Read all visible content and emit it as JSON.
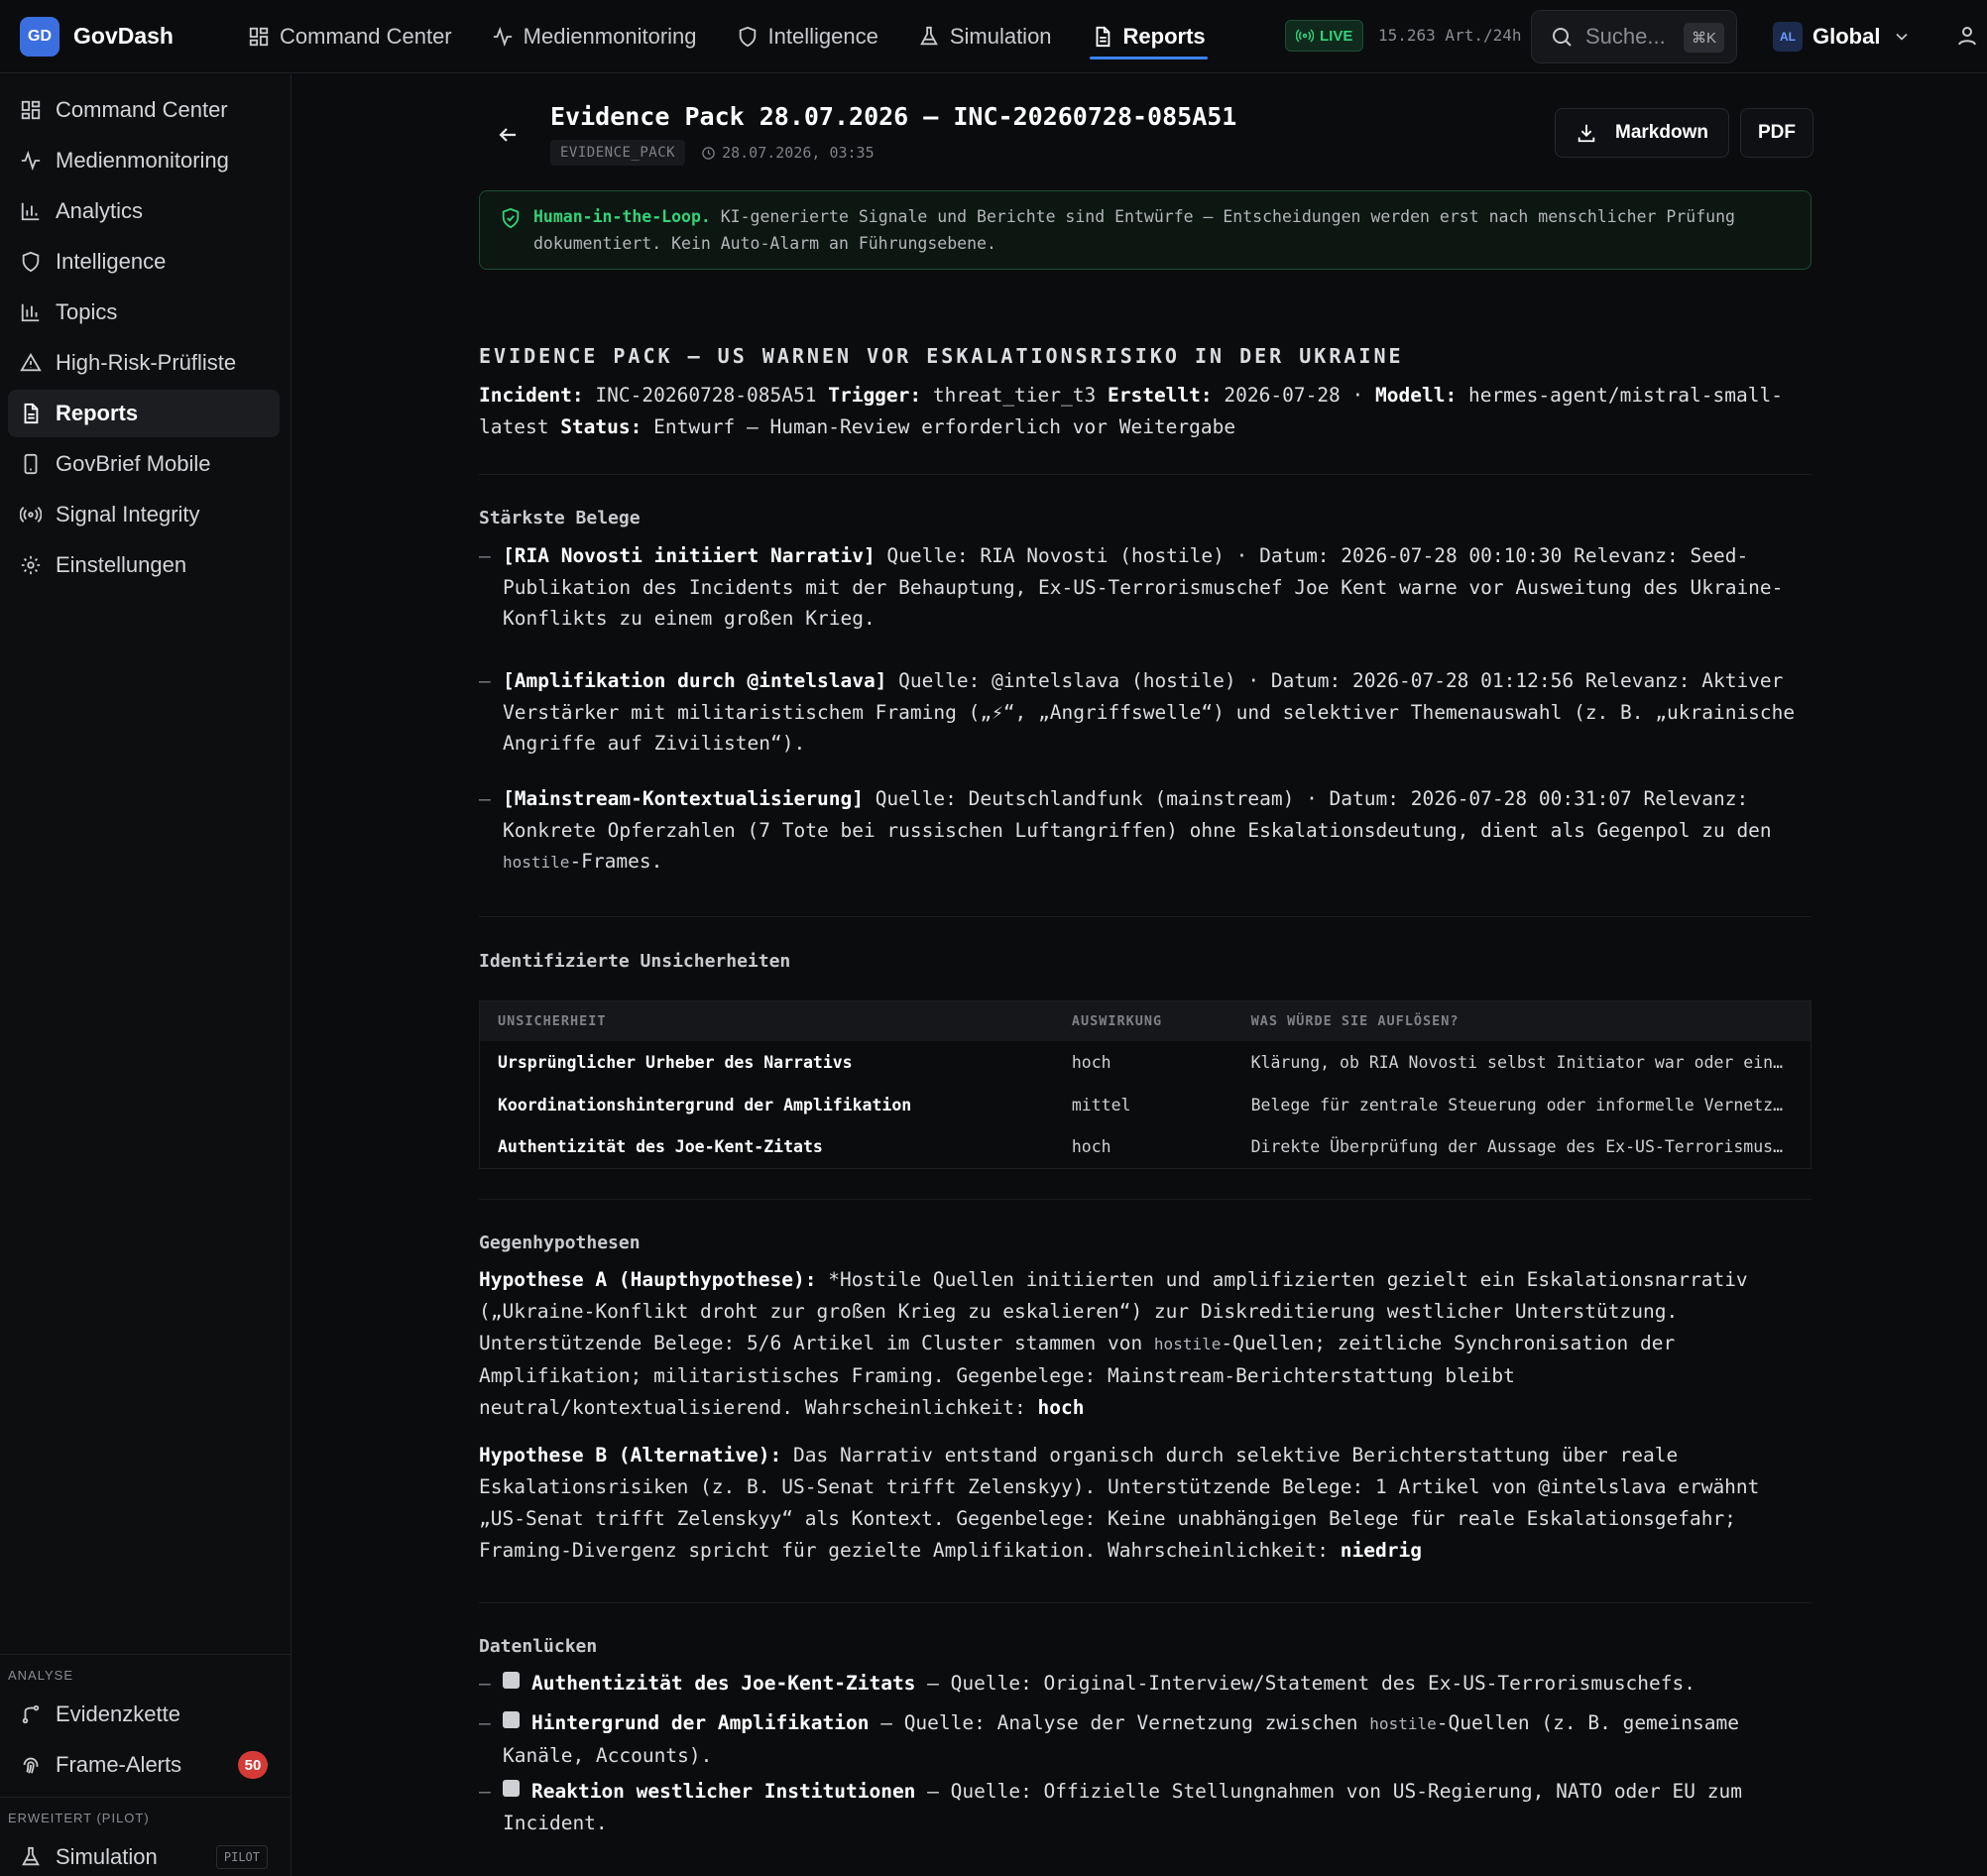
{
  "app": {
    "logo": "GD",
    "name": "GovDash"
  },
  "topnav": [
    {
      "label": "Command Center",
      "icon": "grid-icon"
    },
    {
      "label": "Medienmonitoring",
      "icon": "activity-icon"
    },
    {
      "label": "Intelligence",
      "icon": "shield-icon"
    },
    {
      "label": "Simulation",
      "icon": "flask-icon"
    },
    {
      "label": "Reports",
      "icon": "file-icon",
      "active": true
    }
  ],
  "status": {
    "live": "LIVE",
    "rate": "15.263 Art./24h"
  },
  "search": {
    "placeholder": "Suche...",
    "shortcut": "⌘K"
  },
  "scope": {
    "code": "AL",
    "name": "Global"
  },
  "sidebar": {
    "items": [
      {
        "label": "Command Center",
        "icon": "grid-icon"
      },
      {
        "label": "Medienmonitoring",
        "icon": "activity-icon"
      },
      {
        "label": "Analytics",
        "icon": "bar-chart-icon"
      },
      {
        "label": "Intelligence",
        "icon": "shield-icon"
      },
      {
        "label": "Topics",
        "icon": "bar-chart-icon"
      },
      {
        "label": "High-Risk-Prüfliste",
        "icon": "warning-icon"
      },
      {
        "label": "Reports",
        "icon": "file-icon",
        "active": true
      },
      {
        "label": "GovBrief Mobile",
        "icon": "mobile-icon"
      },
      {
        "label": "Signal Integrity",
        "icon": "radio-icon"
      },
      {
        "label": "Einstellungen",
        "icon": "gear-icon"
      }
    ],
    "analyse_label": "ANALYSE",
    "analyse_items": [
      {
        "label": "Evidenzkette",
        "icon": "branch-icon"
      },
      {
        "label": "Frame-Alerts",
        "icon": "fingerprint-icon",
        "badge": "50"
      }
    ],
    "extended_label": "ERWEITERT (PILOT)",
    "extended_items": [
      {
        "label": "Simulation",
        "icon": "flask-icon",
        "badge": "PILOT"
      }
    ]
  },
  "doc": {
    "title": "Evidence Pack 28.07.2026 — INC-20260728-085A51",
    "type": "EVIDENCE_PACK",
    "timestamp": "28.07.2026, 03:35",
    "btn_markdown": "Markdown",
    "btn_pdf": "PDF"
  },
  "hitl": {
    "title": "Human-in-the-Loop.",
    "text": " KI-generierte Signale und Berichte sind Entwürfe — Entscheidungen werden erst nach menschlicher Prüfung dokumentiert. Kein Auto-Alarm an Führungsebene."
  },
  "report": {
    "heading": "EVIDENCE PACK — US WARNEN VOR ESKALATIONSRISIKO IN DER UKRAINE",
    "meta": {
      "incident_label": "Incident:",
      "incident": " INC-20260728-085A51 ",
      "trigger_label": "Trigger:",
      "trigger": " threat_tier_t3 ",
      "created_label": "Erstellt:",
      "created": " 2026-07-28 · ",
      "model_label": "Modell:",
      "model": " hermes-agent/mistral-small-latest ",
      "status_label": "Status:",
      "status": " Entwurf — Human-Review erforderlich vor Weitergabe"
    },
    "evidence_head": "Stärkste Belege",
    "evidence": [
      {
        "title": "[RIA Novosti initiiert Narrativ]",
        "text": " Quelle: RIA Novosti (hostile) · Datum: 2026-07-28 00:10:30 Relevanz: Seed-Publikation des Incidents mit der Behauptung, Ex-US-Terrorismuschef Joe Kent warne vor Ausweitung des Ukraine-Konflikts zu einem großen Krieg."
      },
      {
        "title": "[Amplifikation durch @intelslava]",
        "text": " Quelle: @intelslava (hostile) · Datum: 2026-07-28 01:12:56 Relevanz: Aktiver Verstärker mit militaristischem Framing („⚡“, „Angriffswelle“) und selektiver Themenauswahl (z. B. „ukrainische Angriffe auf Zivilisten“)."
      },
      {
        "title": "[Mainstream-Kontextualisierung]",
        "text": " Quelle: Deutschlandfunk (mainstream) · Datum: 2026-07-28 00:31:07 Relevanz: Konkrete Opferzahlen (7 Tote bei russischen Luftangriffen) ohne Eskalationsdeutung, dient als Gegenpol zu den ",
        "code": "hostile",
        "tail": "-Frames."
      }
    ],
    "uncertainty_head": "Identifizierte Unsicherheiten",
    "uncertainty_cols": [
      "UNSICHERHEIT",
      "AUSWIRKUNG",
      "WAS WÜRDE SIE AUFLÖSEN?"
    ],
    "uncertainty_rows": [
      {
        "u": "Ursprünglicher Urheber des Narrativs",
        "impact": "hoch",
        "resolve": "Klärung, ob RIA Novosti selbst Initiator war oder ein…"
      },
      {
        "u": "Koordinationshintergrund der Amplifikation",
        "impact": "mittel",
        "resolve": "Belege für zentrale Steuerung oder informelle Vernetz…"
      },
      {
        "u": "Authentizität des Joe-Kent-Zitats",
        "impact": "hoch",
        "resolve": "Direkte Überprüfung der Aussage des Ex-US-Terrorismus…"
      }
    ],
    "hyp_head": "Gegenhypothesen",
    "hyp_a": {
      "label": "Hypothese A (Haupthypothese):",
      "t1": " *Hostile Quellen initiierten und amplifizierten gezielt ein Eskalationsnarrativ („Ukraine-Konflikt droht zur großen Krieg zu eskalieren“) zur Diskreditierung westlicher Unterstützung. Unterstützende Belege: 5/6 Artikel im Cluster stammen von ",
      "code": "hostile",
      "t2": "-Quellen; zeitliche Synchronisation der Amplifikation; militaristisches Framing. Gegenbelege: Mainstream-Berichterstattung bleibt neutral/kontextualisierend. Wahrscheinlichkeit: ",
      "prob": "hoch"
    },
    "hyp_b": {
      "label": "Hypothese B (Alternative):",
      "t1": " Das Narrativ entstand organisch durch selektive Berichterstattung über reale Eskalationsrisiken (z. B. US-Senat trifft Zelenskyy). Unterstützende Belege: 1 Artikel von @intelslava erwähnt „US-Senat trifft Zelenskyy“ als Kontext. Gegenbelege: Keine unabhängigen Belege für reale Eskalationsgefahr; Framing-Divergenz spricht für gezielte Amplifikation. Wahrscheinlichkeit: ",
      "prob": "niedrig"
    },
    "gaps_head": "Datenlücken",
    "gaps": [
      {
        "title": "Authentizität des Joe-Kent-Zitats",
        "text": " — Quelle: Original-Interview/Statement des Ex-US-Terrorismuschefs."
      },
      {
        "title": "Hintergrund der Amplifikation",
        "text": " — Quelle: Analyse der Vernetzung zwischen ",
        "code": "hostile",
        "tail": "-Quellen (z. B. gemeinsame Kanäle, Accounts)."
      },
      {
        "title": "Reaktion westlicher Institutionen",
        "text": " — Quelle: Offizielle Stellungnahmen von US-Regierung, NATO oder EU zum Incident."
      }
    ]
  },
  "colors": {
    "accent": "#3b82f6",
    "live": "#34d27a",
    "badge": "#d43b36",
    "background": "#0b0c0e"
  }
}
